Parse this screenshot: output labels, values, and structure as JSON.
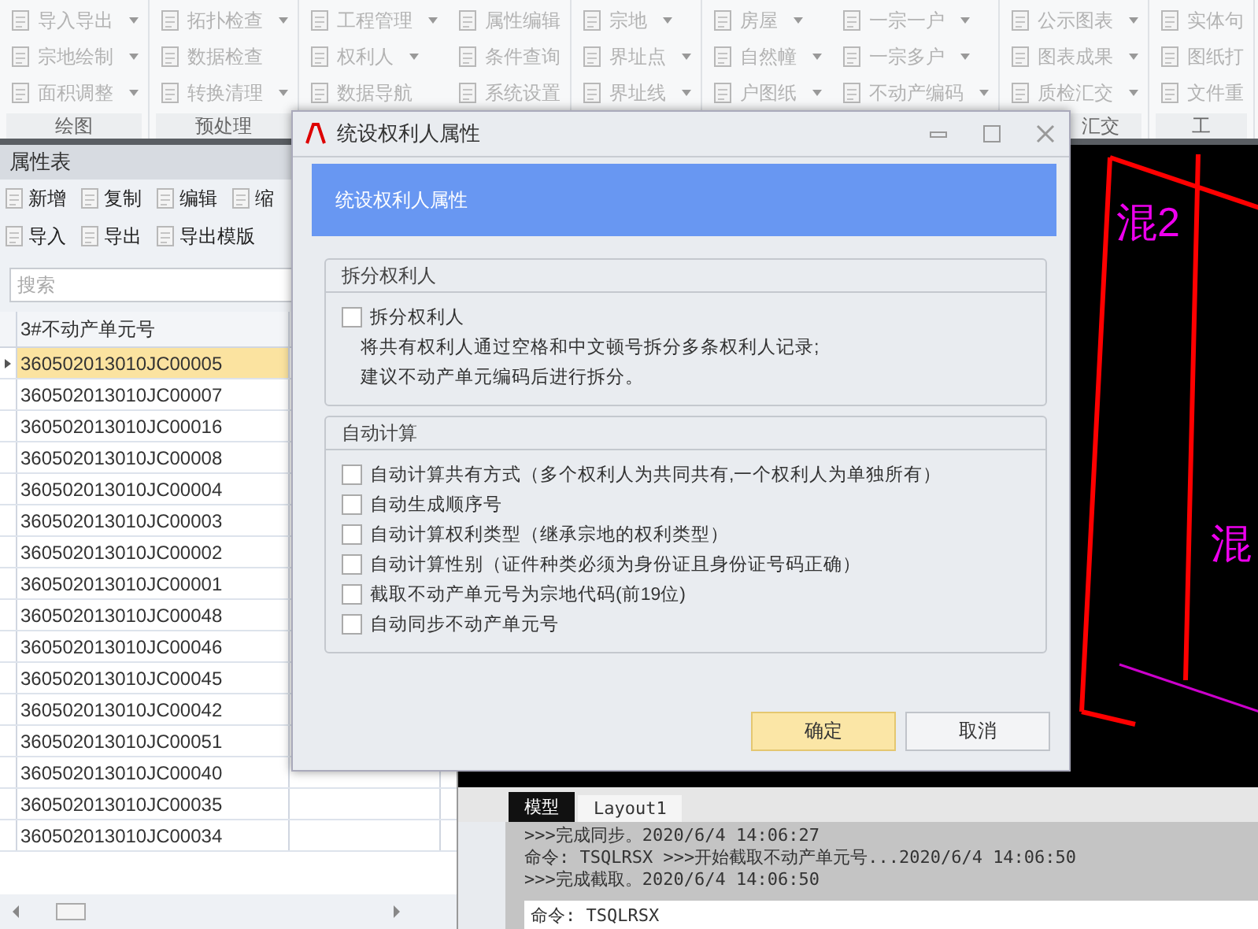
{
  "ribbon": {
    "groups": [
      {
        "label": "绘图",
        "columns": [
          [
            {
              "label": "导入导出",
              "dropdown": true
            },
            {
              "label": "宗地绘制",
              "dropdown": true
            },
            {
              "label": "面积调整",
              "dropdown": true
            }
          ]
        ]
      },
      {
        "label": "预处理",
        "columns": [
          [
            {
              "label": "拓扑检查",
              "dropdown": true
            },
            {
              "label": "数据检查",
              "dropdown": false
            },
            {
              "label": "转换清理",
              "dropdown": true
            }
          ]
        ]
      },
      {
        "columns": [
          [
            {
              "label": "工程管理",
              "dropdown": true
            },
            {
              "label": "权利人",
              "dropdown": true
            },
            {
              "label": "数据导航",
              "dropdown": false
            }
          ],
          [
            {
              "label": "属性编辑",
              "dropdown": false
            },
            {
              "label": "条件查询",
              "dropdown": false
            },
            {
              "label": "系统设置",
              "dropdown": false
            }
          ]
        ]
      },
      {
        "columns": [
          [
            {
              "label": "宗地",
              "dropdown": true
            },
            {
              "label": "界址点",
              "dropdown": true
            },
            {
              "label": "界址线",
              "dropdown": true
            }
          ]
        ]
      },
      {
        "columns": [
          [
            {
              "label": "房屋",
              "dropdown": true
            },
            {
              "label": "自然幢",
              "dropdown": true
            },
            {
              "label": "户图纸",
              "dropdown": true
            }
          ],
          [
            {
              "label": "一宗一户",
              "dropdown": true
            },
            {
              "label": "一宗多户",
              "dropdown": true
            },
            {
              "label": "不动产编码",
              "dropdown": true
            }
          ]
        ]
      },
      {
        "label": "汇交",
        "columns": [
          [
            {
              "label": "公示图表",
              "dropdown": true
            },
            {
              "label": "图表成果",
              "dropdown": true
            },
            {
              "label": "质检汇交",
              "dropdown": true
            }
          ]
        ]
      },
      {
        "label": "工",
        "columns": [
          [
            {
              "label": "实体句",
              "dropdown": false
            },
            {
              "label": "图纸打",
              "dropdown": false
            },
            {
              "label": "文件重",
              "dropdown": false
            }
          ]
        ]
      }
    ]
  },
  "attribute_panel": {
    "title": "属性表",
    "toolbar_rows": [
      [
        "新增",
        "复制",
        "编辑",
        "缩"
      ],
      [
        "导入",
        "导出",
        "导出模版"
      ]
    ],
    "search": {
      "placeholder": "搜索"
    },
    "table": {
      "columns": [
        "3#不动产单元号"
      ],
      "rows": [
        {
          "value": "360502013010JC00005",
          "selected": true
        },
        {
          "value": "360502013010JC00007",
          "selected": false
        },
        {
          "value": "360502013010JC00016",
          "selected": false
        },
        {
          "value": "360502013010JC00008",
          "selected": false
        },
        {
          "value": "360502013010JC00004",
          "selected": false
        },
        {
          "value": "360502013010JC00003",
          "selected": false
        },
        {
          "value": "360502013010JC00002",
          "selected": false
        },
        {
          "value": "360502013010JC00001",
          "selected": false
        },
        {
          "value": "360502013010JC00048",
          "selected": false
        },
        {
          "value": "360502013010JC00046",
          "selected": false
        },
        {
          "value": "360502013010JC00045",
          "selected": false
        },
        {
          "value": "360502013010JC00042",
          "selected": false
        },
        {
          "value": "360502013010JC00051",
          "selected": false
        },
        {
          "value": "360502013010JC00040",
          "selected": false
        },
        {
          "value": "360502013010JC00035",
          "selected": false
        },
        {
          "value": "360502013010JC00034",
          "selected": false
        }
      ]
    }
  },
  "canvas": {
    "labels": [
      "混2",
      "混"
    ]
  },
  "layout_tabs": [
    {
      "label": "模型",
      "selected": true
    },
    {
      "label": "Layout1",
      "selected": false
    }
  ],
  "command_history": [
    ">>>完成同步。2020/6/4 14:06:27",
    "命令: TSQLRSX >>>开始截取不动产单元号...2020/6/4 14:06:50",
    ">>>完成截取。2020/6/4 14:06:50"
  ],
  "command_input": {
    "value": "命令: TSQLRSX"
  },
  "dialog": {
    "title": "统设权利人属性",
    "banner": "统设权利人属性",
    "groups": [
      {
        "title": "拆分权利人",
        "options": [
          {
            "label": "拆分权利人",
            "checked": false
          }
        ],
        "notes": [
          "将共有权利人通过空格和中文顿号拆分多条权利人记录;",
          "建议不动产单元编码后进行拆分。"
        ]
      },
      {
        "title": "自动计算",
        "options": [
          {
            "label": "自动计算共有方式（多个权利人为共同共有,一个权利人为单独所有）",
            "checked": false
          },
          {
            "label": "自动生成顺序号",
            "checked": false
          },
          {
            "label": "自动计算权利类型（继承宗地的权利类型）",
            "checked": false
          },
          {
            "label": "自动计算性别（证件种类必须为身份证且身份证号码正确）",
            "checked": false
          },
          {
            "label": "截取不动产单元号为宗地代码(前19位)",
            "checked": false
          },
          {
            "label": "自动同步不动产单元号",
            "checked": false
          }
        ]
      }
    ],
    "buttons": [
      {
        "label": "确定",
        "kind": "primary"
      },
      {
        "label": "取消",
        "kind": "normal"
      }
    ]
  }
}
